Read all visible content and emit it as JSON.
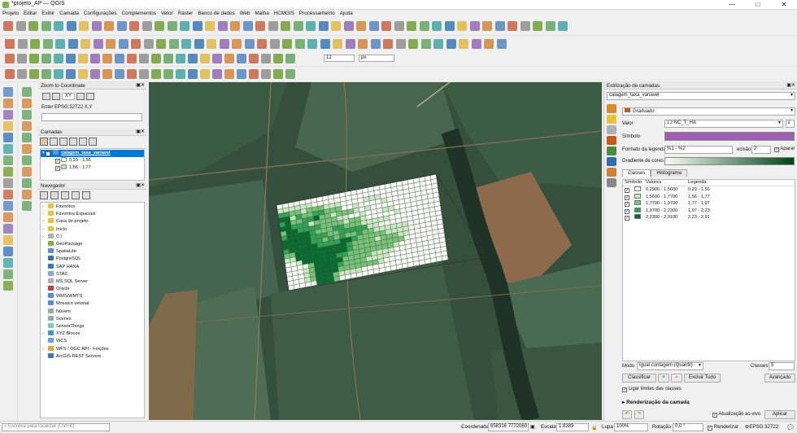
{
  "window": {
    "title": "*projeto_AP — QGIS",
    "minimize": "—",
    "maximize": "□",
    "close": "✕"
  },
  "menu": [
    "Projeto",
    "Editar",
    "Exibir",
    "Camada",
    "Configurações",
    "Complementos",
    "Vetor",
    "Raster",
    "Banco de dados",
    "Web",
    "Malha",
    "HCMGIS",
    "Processamento",
    "Ajuda"
  ],
  "zoom_panel": {
    "title": "Zoom to Coordinate",
    "enter_label": "Enter EPSG:32722 X,Y",
    "xy_button": "XY"
  },
  "layers_panel": {
    "title": "Camadas",
    "layer_name": "calagem_taxa_variavel",
    "items": [
      {
        "range": "0,29 - 1,56",
        "color": "#f2f9ef"
      },
      {
        "range": "1,56 - 1,77",
        "color": "#bfe3b5"
      }
    ]
  },
  "browser_panel": {
    "title": "Navegador",
    "items": [
      "Favoritos",
      "Favoritos Espaciais",
      "Casa do projeto",
      "Início",
      "C:\\",
      "GeoPackage",
      "SpatiaLite",
      "PostgreSQL",
      "SAP HANA",
      "STAC",
      "MS SQL Server",
      "Oracle",
      "WMS/WMTS",
      "Mosaico vetorial",
      "Núvem",
      "Scenes",
      "SensorThings",
      "XYZ Blocos",
      "WCS",
      "WFS / OGC API - Feições",
      "ArcGIS REST Servers"
    ]
  },
  "style_panel": {
    "title": "Estilização de camadas",
    "layer": "calagem_taxa_variavel",
    "renderer": "Graduado",
    "value_label": "Valor",
    "value_type": "1.2",
    "value_field": "NC_T_HA",
    "symbol_label": "Símbolo",
    "legend_format_label": "Formato da legenda",
    "legend_format": "%1 - %2",
    "precision_label": "ecisão",
    "precision": "2",
    "trim_label": "Aparar",
    "ramp_label": "Gradiente de cores",
    "tabs": [
      "Classes",
      "Histograma"
    ],
    "columns": [
      "Símbolo",
      "Valores",
      "Legenda"
    ],
    "classes": [
      {
        "values": "0,2900 - 1,5600",
        "legend": "0,29 - 1,56",
        "color": "#f7fcf5"
      },
      {
        "values": "1,5600 - 1,7700",
        "legend": "1,56 - 1,77",
        "color": "#c7e9c0"
      },
      {
        "values": "1,7700 - 1,9700",
        "legend": "1,77 - 1,97",
        "color": "#74c476"
      },
      {
        "values": "1,9700 - 2,2300",
        "legend": "1,97 - 2,23",
        "color": "#31a354"
      },
      {
        "values": "2,2300 - 2,9100",
        "legend": "2,23 - 2,91",
        "color": "#006d2c"
      }
    ],
    "mode_label": "Modo",
    "mode": "Igual contagem (Quantil)",
    "classes_label": "Classes",
    "classes_count": "5",
    "classify_btn": "Classificar",
    "delete_all_btn": "Excluir Tudo",
    "advanced_btn": "Avançado",
    "link_label": "Ligar limites das classes",
    "render_section": "Renderização da camada",
    "live_update": "Atualização ao vivo",
    "apply_btn": "Aplicar"
  },
  "status": {
    "search_placeholder": "Escreva para localizar (Ctrl+K)",
    "coord_label": "Coordenada",
    "coord": "658316 7772060",
    "scale_label": "Escala",
    "scale": "1:8389",
    "zoom_label": "Lupa",
    "zoom": "100%",
    "rotation_label": "Rotação",
    "rotation": "0,0 °",
    "render_label": "Renderizar",
    "crs": "EPSG:32722"
  },
  "colors": {
    "symbol": "#a05fb5",
    "ramp_start": "#f7fcf5",
    "ramp_end": "#00441b",
    "selection": "#0078d7"
  },
  "grid_values": {
    "rows": [
      "0000000000000000000000000000",
      "1111110000000000000000000000",
      "3322122211100001110000000000",
      "4413223322200100001000000000",
      "3422334221222101000000000000",
      "4433312222110010001100000000",
      "2443333222212210000010000000",
      "3444432223322211111000000000",
      "4444433322333331100000000000",
      "4444433232322322111111000000",
      "3444443333443222221111000000",
      "2244444444432222122211000000",
      "1144444444432222222220000000",
      "0014444443322222222100000000",
      "0000244444222221111000000000",
      "0001244443222211110000000000",
      "0001244442222222100000000000",
      "0001244421111000000000000000",
      "0000044420000000000000000000"
    ]
  }
}
